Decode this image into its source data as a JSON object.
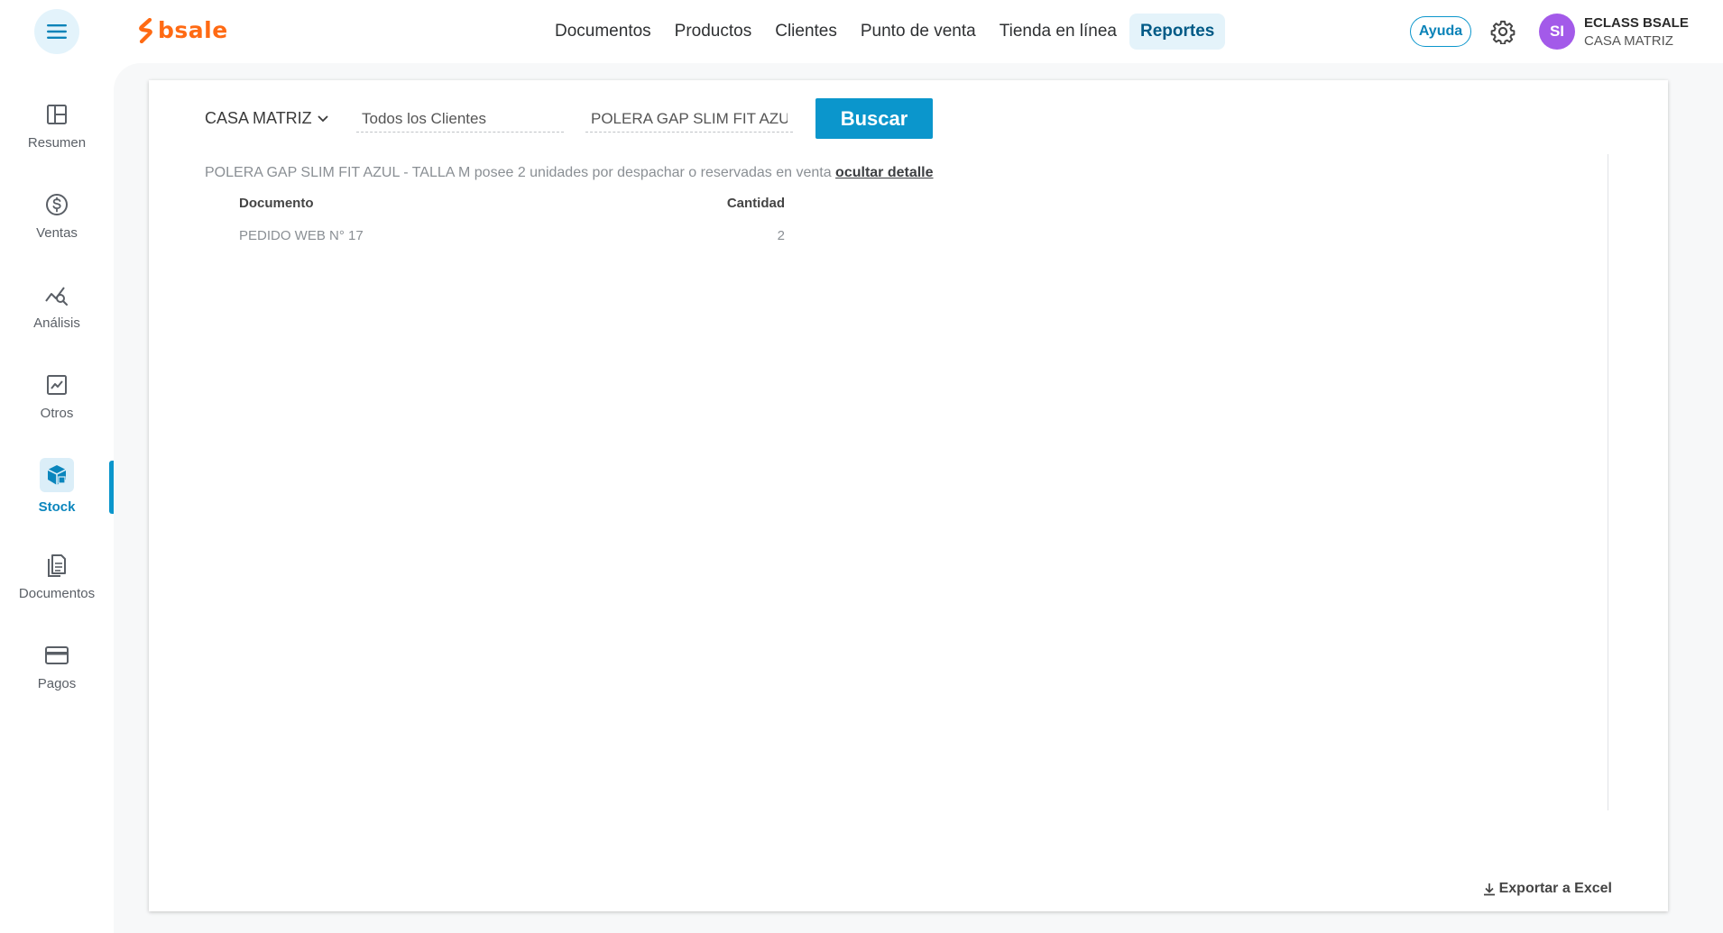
{
  "app": {
    "logo_text": "bsale",
    "brand_color": "#ff6a13",
    "accent_color": "#0b96cc"
  },
  "nav": {
    "items": [
      {
        "label": "Documentos",
        "active": false
      },
      {
        "label": "Productos",
        "active": false
      },
      {
        "label": "Clientes",
        "active": false
      },
      {
        "label": "Punto de venta",
        "active": false
      },
      {
        "label": "Tienda en línea",
        "active": false
      },
      {
        "label": "Reportes",
        "active": true
      }
    ]
  },
  "header": {
    "help_label": "Ayuda",
    "avatar_initials": "SI",
    "user_name": "ECLASS BSALE",
    "user_branch": "CASA MATRIZ"
  },
  "sidebar": {
    "items": [
      {
        "label": "Resumen",
        "icon": "layout-icon"
      },
      {
        "label": "Ventas",
        "icon": "dollar-icon"
      },
      {
        "label": "Análisis",
        "icon": "analysis-icon"
      },
      {
        "label": "Otros",
        "icon": "chart-icon"
      },
      {
        "label": "Stock",
        "icon": "box-icon",
        "active": true
      },
      {
        "label": "Documentos",
        "icon": "document-icon"
      },
      {
        "label": "Pagos",
        "icon": "card-icon"
      }
    ]
  },
  "filters": {
    "branch": "CASA MATRIZ",
    "clients_value": "Todos los Clientes",
    "product_value": "POLERA GAP SLIM FIT AZUL - TALLA M",
    "search_label": "Buscar"
  },
  "detail": {
    "message": "POLERA GAP SLIM FIT AZUL - TALLA M posee 2 unidades por despachar o reservadas en venta ",
    "hide_link": "ocultar detalle",
    "columns": [
      "Documento",
      "Cantidad"
    ],
    "rows": [
      {
        "documento": "PEDIDO WEB N° 17",
        "cantidad": "2"
      }
    ]
  },
  "export_label": "Exportar a Excel"
}
